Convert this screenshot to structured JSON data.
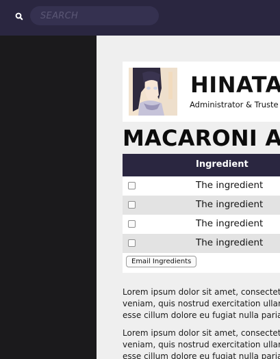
{
  "search": {
    "placeholder": "SEARCH",
    "icon": "search-icon"
  },
  "profile": {
    "name": "HINATA",
    "role": "Administrator & Truste"
  },
  "recipe": {
    "title": "MACARONI AN"
  },
  "ingredients_table": {
    "header": "Ingredient",
    "rows": [
      {
        "checked": false,
        "label": "The ingredient"
      },
      {
        "checked": false,
        "label": "The ingredient"
      },
      {
        "checked": false,
        "label": "The ingredient"
      },
      {
        "checked": false,
        "label": "The ingredient"
      }
    ],
    "email_button": "Email Ingredients"
  },
  "paragraphs": [
    {
      "lines": [
        "Lorem ipsum dolor sit amet, consectetu",
        "veniam, quis nostrud exercitation ullamc",
        "esse cillum dolore eu fugiat nulla pariatur"
      ]
    },
    {
      "lines": [
        "Lorem ipsum dolor sit amet, consectetu",
        "veniam, quis nostrud exercitation ullamc",
        "esse cillum dolore eu fugiat nulla pariatur"
      ]
    }
  ],
  "colors": {
    "topbar": "#2a2640",
    "sidebar": "#1b1a1c",
    "content_bg": "#efefef",
    "table_header": "#2a2640",
    "row_alt": "#e3e3e3"
  }
}
